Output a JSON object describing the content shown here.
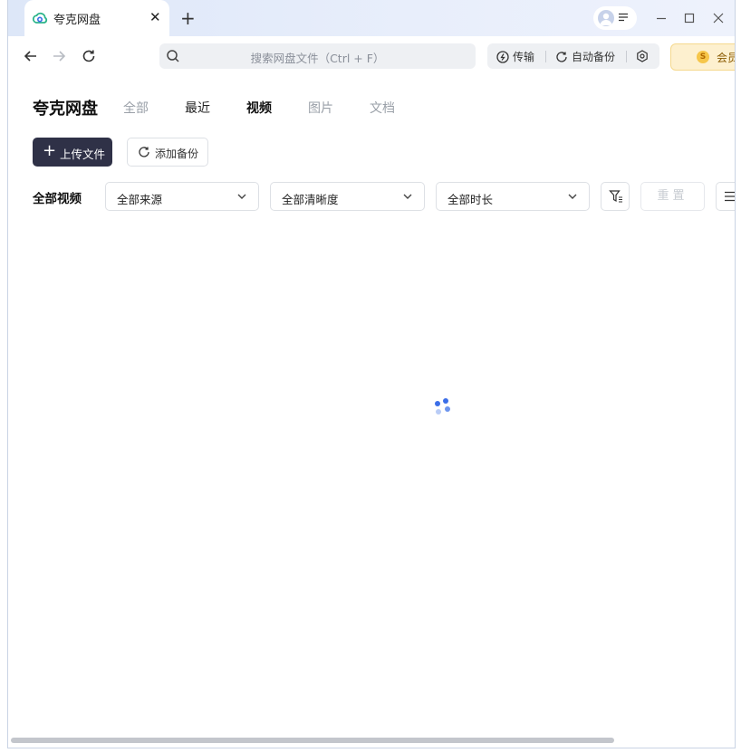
{
  "browser": {
    "tab_title": "夸克网盘",
    "tab_close": "✕",
    "new_tab": "+"
  },
  "toolbar": {
    "search_placeholder": "搜索网盘文件（Ctrl + F）",
    "transfer_label": "传输",
    "auto_backup_label": "自动备份",
    "vip_label": "会员"
  },
  "header": {
    "brand": "夸克网盘",
    "tabs": [
      "全部",
      "最近",
      "视频",
      "图片",
      "文档"
    ],
    "active_tab": "视频"
  },
  "actions": {
    "upload_plus": "+",
    "upload_label": "上传文件",
    "add_backup_label": "添加备份"
  },
  "filters": {
    "label": "全部视频",
    "source": "全部来源",
    "resolution": "全部清晰度",
    "duration": "全部时长",
    "reset_label": "重置"
  },
  "colors": {
    "primary_dark": "#2f3147",
    "accent_blue": "#3b6ee8",
    "vip_bg": "#fdf0cf",
    "titlebar": "#e3eaf9"
  },
  "icons": {
    "back": "arrow-left-icon",
    "forward": "arrow-right-icon",
    "refresh": "refresh-icon",
    "search": "search-icon",
    "settings": "hexagon-gear-icon",
    "filter": "filter-icon",
    "list": "list-icon"
  }
}
